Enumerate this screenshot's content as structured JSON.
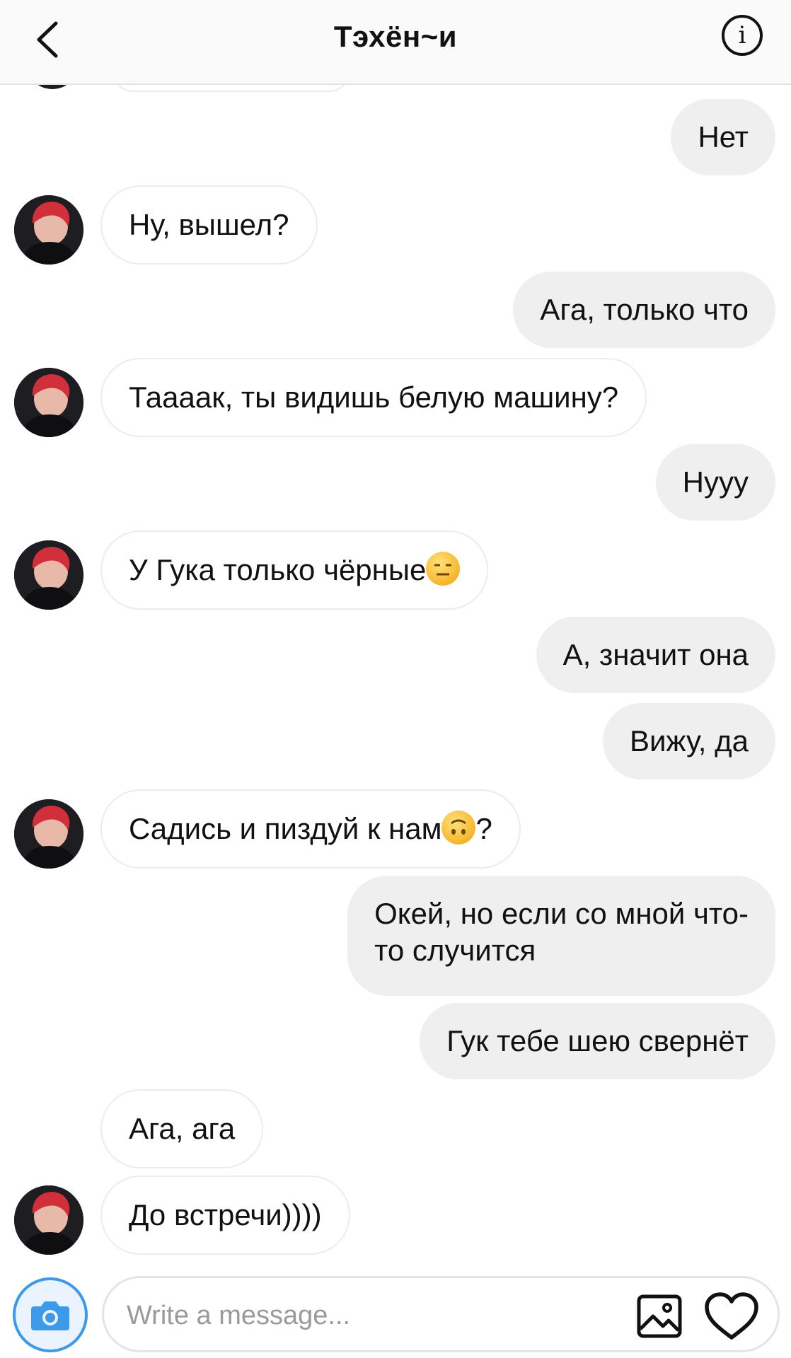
{
  "header": {
    "title": "Тэхён~и",
    "back_icon": "chevron-left-icon",
    "info_icon": "info-icon",
    "info_glyph": "i"
  },
  "messages": [
    {
      "side": "out",
      "text": "Нет"
    },
    {
      "side": "in",
      "text": "Ну, вышел?",
      "avatar": true
    },
    {
      "side": "out",
      "text": "Ага, только что"
    },
    {
      "side": "in",
      "text": "Таааак, ты видишь белую машину?",
      "avatar": true
    },
    {
      "side": "out",
      "text": "Нууу"
    },
    {
      "side": "in",
      "text": "У Гука только чёрные",
      "emoji": "expressionless-emoji",
      "avatar": true
    },
    {
      "side": "out",
      "text": "А, значит она"
    },
    {
      "side": "out",
      "text": "Вижу, да"
    },
    {
      "side": "in",
      "text": "Садись и пиздуй к нам",
      "emoji": "upside-down-emoji",
      "after_emoji": "?",
      "avatar": true
    },
    {
      "side": "out",
      "text": "Окей, но если со мной что-\nто случится"
    },
    {
      "side": "out",
      "text": "Гук тебе шею свернёт"
    },
    {
      "side": "in",
      "text": "Ага, ага",
      "avatar": false
    },
    {
      "side": "in",
      "text": "До встречи))))",
      "avatar": true
    }
  ],
  "composer": {
    "placeholder": "Write a message...",
    "camera_icon": "camera-icon",
    "gallery_icon": "image-gallery-icon",
    "like_icon": "heart-icon"
  },
  "colors": {
    "outgoing_bubble": "#efefef",
    "incoming_border": "#ececec",
    "camera_accent": "#3d9ae8"
  }
}
